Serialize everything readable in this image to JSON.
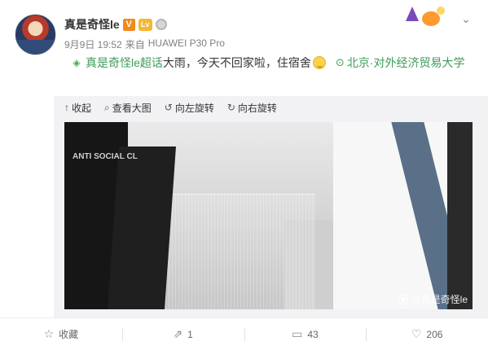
{
  "user": {
    "name": "真是奇怪le",
    "vip_badge": "V",
    "level_badge": "Lv",
    "avatar_icon": "avatar-image"
  },
  "meta": {
    "date": "9月9日 19:52",
    "source_prefix": "来自",
    "device": "HUAWEI P30 Pro"
  },
  "post": {
    "topic": "真是奇怪le超话",
    "text": "大雨，今天不回家啦，住宿舍",
    "location": "北京·对外经济贸易大学"
  },
  "media_toolbar": {
    "collapse": "收起",
    "view_large": "查看大图",
    "rotate_left": "向左旋转",
    "rotate_right": "向右旋转"
  },
  "photo": {
    "shirt_text": "ANTI SOCIAL CL",
    "watermark": "@真是奇怪le"
  },
  "actions": {
    "favorite": "收藏",
    "repost": "1",
    "comment": "43",
    "like": "206"
  },
  "colors": {
    "topic_green": "#3d9c58",
    "meta_gray": "#808080",
    "vip_orange": "#f28a1a"
  }
}
